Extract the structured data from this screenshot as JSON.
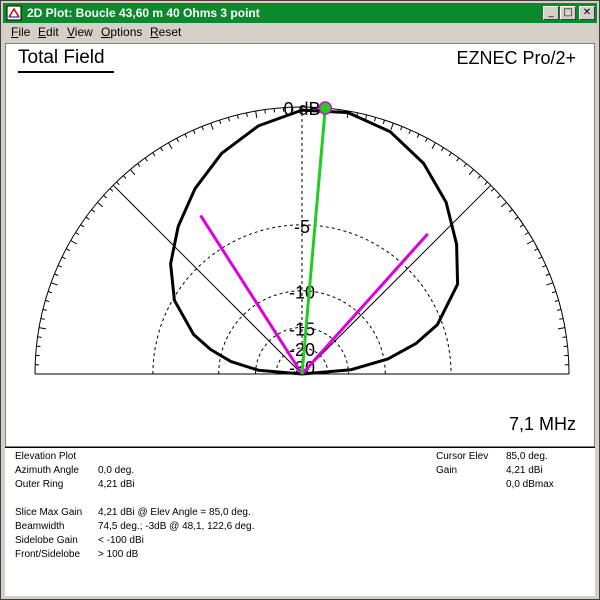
{
  "window": {
    "title": "2D Plot: Boucle 43,60 m 40 Ohms 3 point",
    "minimize_glyph": "_",
    "maximize_glyph": "□",
    "close_glyph": "✕",
    "titlebar_color": "#0a8a2c"
  },
  "menu": {
    "file": {
      "mnemonic": "F",
      "rest": "ile"
    },
    "edit": {
      "mnemonic": "E",
      "rest": "dit"
    },
    "view": {
      "mnemonic": "V",
      "rest": "iew"
    },
    "options": {
      "mnemonic": "O",
      "rest": "ptions"
    },
    "reset": {
      "mnemonic": "R",
      "rest": "eset"
    }
  },
  "plot": {
    "title": "Total Field",
    "brand": "EZNEC Pro/2+",
    "frequency": "7,1 MHz",
    "ring_labels": [
      "0 dB",
      "-5",
      "-10",
      "-15",
      "-20",
      "-30"
    ],
    "colors": {
      "pattern": "#000000",
      "cursor": "#22cc22",
      "beamwidth": "#dd00dd"
    }
  },
  "chart_data": {
    "type": "polar-elevation",
    "title": "Total Field",
    "scale": "log dB",
    "rings_db": [
      0,
      -5,
      -10,
      -15,
      -20,
      -30
    ],
    "cursor_elevation_deg": 85.0,
    "max_gain_elevation_deg": 85.0,
    "minus3db_angles_deg": [
      48.1,
      122.6
    ],
    "pattern": {
      "elevation_deg": [
        0,
        5,
        10,
        15,
        20,
        30,
        40,
        50,
        60,
        70,
        80,
        90,
        100,
        110,
        120,
        130,
        140,
        150,
        160,
        165,
        170,
        175,
        180
      ],
      "relative_db": [
        -99,
        -14.5,
        -9.6,
        -7.0,
        -5.3,
        -3.4,
        -2.4,
        -1.5,
        -0.8,
        -0.3,
        -0.05,
        -0.1,
        -0.5,
        -1.1,
        -1.9,
        -2.8,
        -3.8,
        -5.1,
        -7.2,
        -8.9,
        -11.2,
        -15.5,
        -99
      ]
    }
  },
  "info": {
    "plot_type": "Elevation Plot",
    "azimuth_angle": {
      "label": "Azimuth Angle",
      "value": "0,0 deg."
    },
    "outer_ring": {
      "label": "Outer Ring",
      "value": "4,21 dBi"
    },
    "slice_max_gain": {
      "label": "Slice Max Gain",
      "value": "4,21 dBi @ Elev Angle = 85,0 deg."
    },
    "beamwidth": {
      "label": "Beamwidth",
      "value": "74,5 deg.; -3dB @ 48,1, 122,6 deg."
    },
    "sidelobe_gain": {
      "label": "Sidelobe Gain",
      "value": "< -100 dBi"
    },
    "front_sidelobe": {
      "label": "Front/Sidelobe",
      "value": "> 100 dB"
    },
    "cursor_elev": {
      "label": "Cursor Elev",
      "value": "85,0 deg."
    },
    "gain": {
      "label": "Gain",
      "value": "4,21 dBi",
      "value2": "0,0 dBmax"
    }
  }
}
